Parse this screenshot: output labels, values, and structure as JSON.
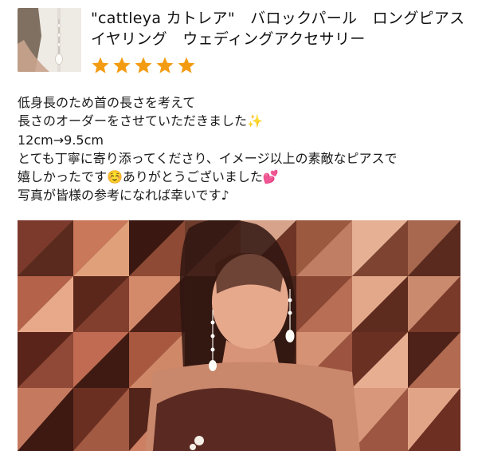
{
  "product": {
    "title": "\"cattleya カトレア\"　バロックパール　ロングピアス　イヤリング　ウェディングアクセサリー",
    "rating": 5,
    "star_color": "#f39c12",
    "star_icon": "star-icon"
  },
  "review": {
    "lines": [
      "低身長のため首の長さを考えて",
      "長さのオーダーをさせていただきました✨",
      "12cm→9.5cm",
      "とても丁寧に寄り添ってくださり、イメージ以上の素敵なピアスで",
      "嬉しかったです☺️ありがとうございました💕",
      "写真が皆様の参考になれば幸いです♪"
    ]
  },
  "colors": {
    "text": "#1a1a1a",
    "accent": "#f39c12"
  }
}
